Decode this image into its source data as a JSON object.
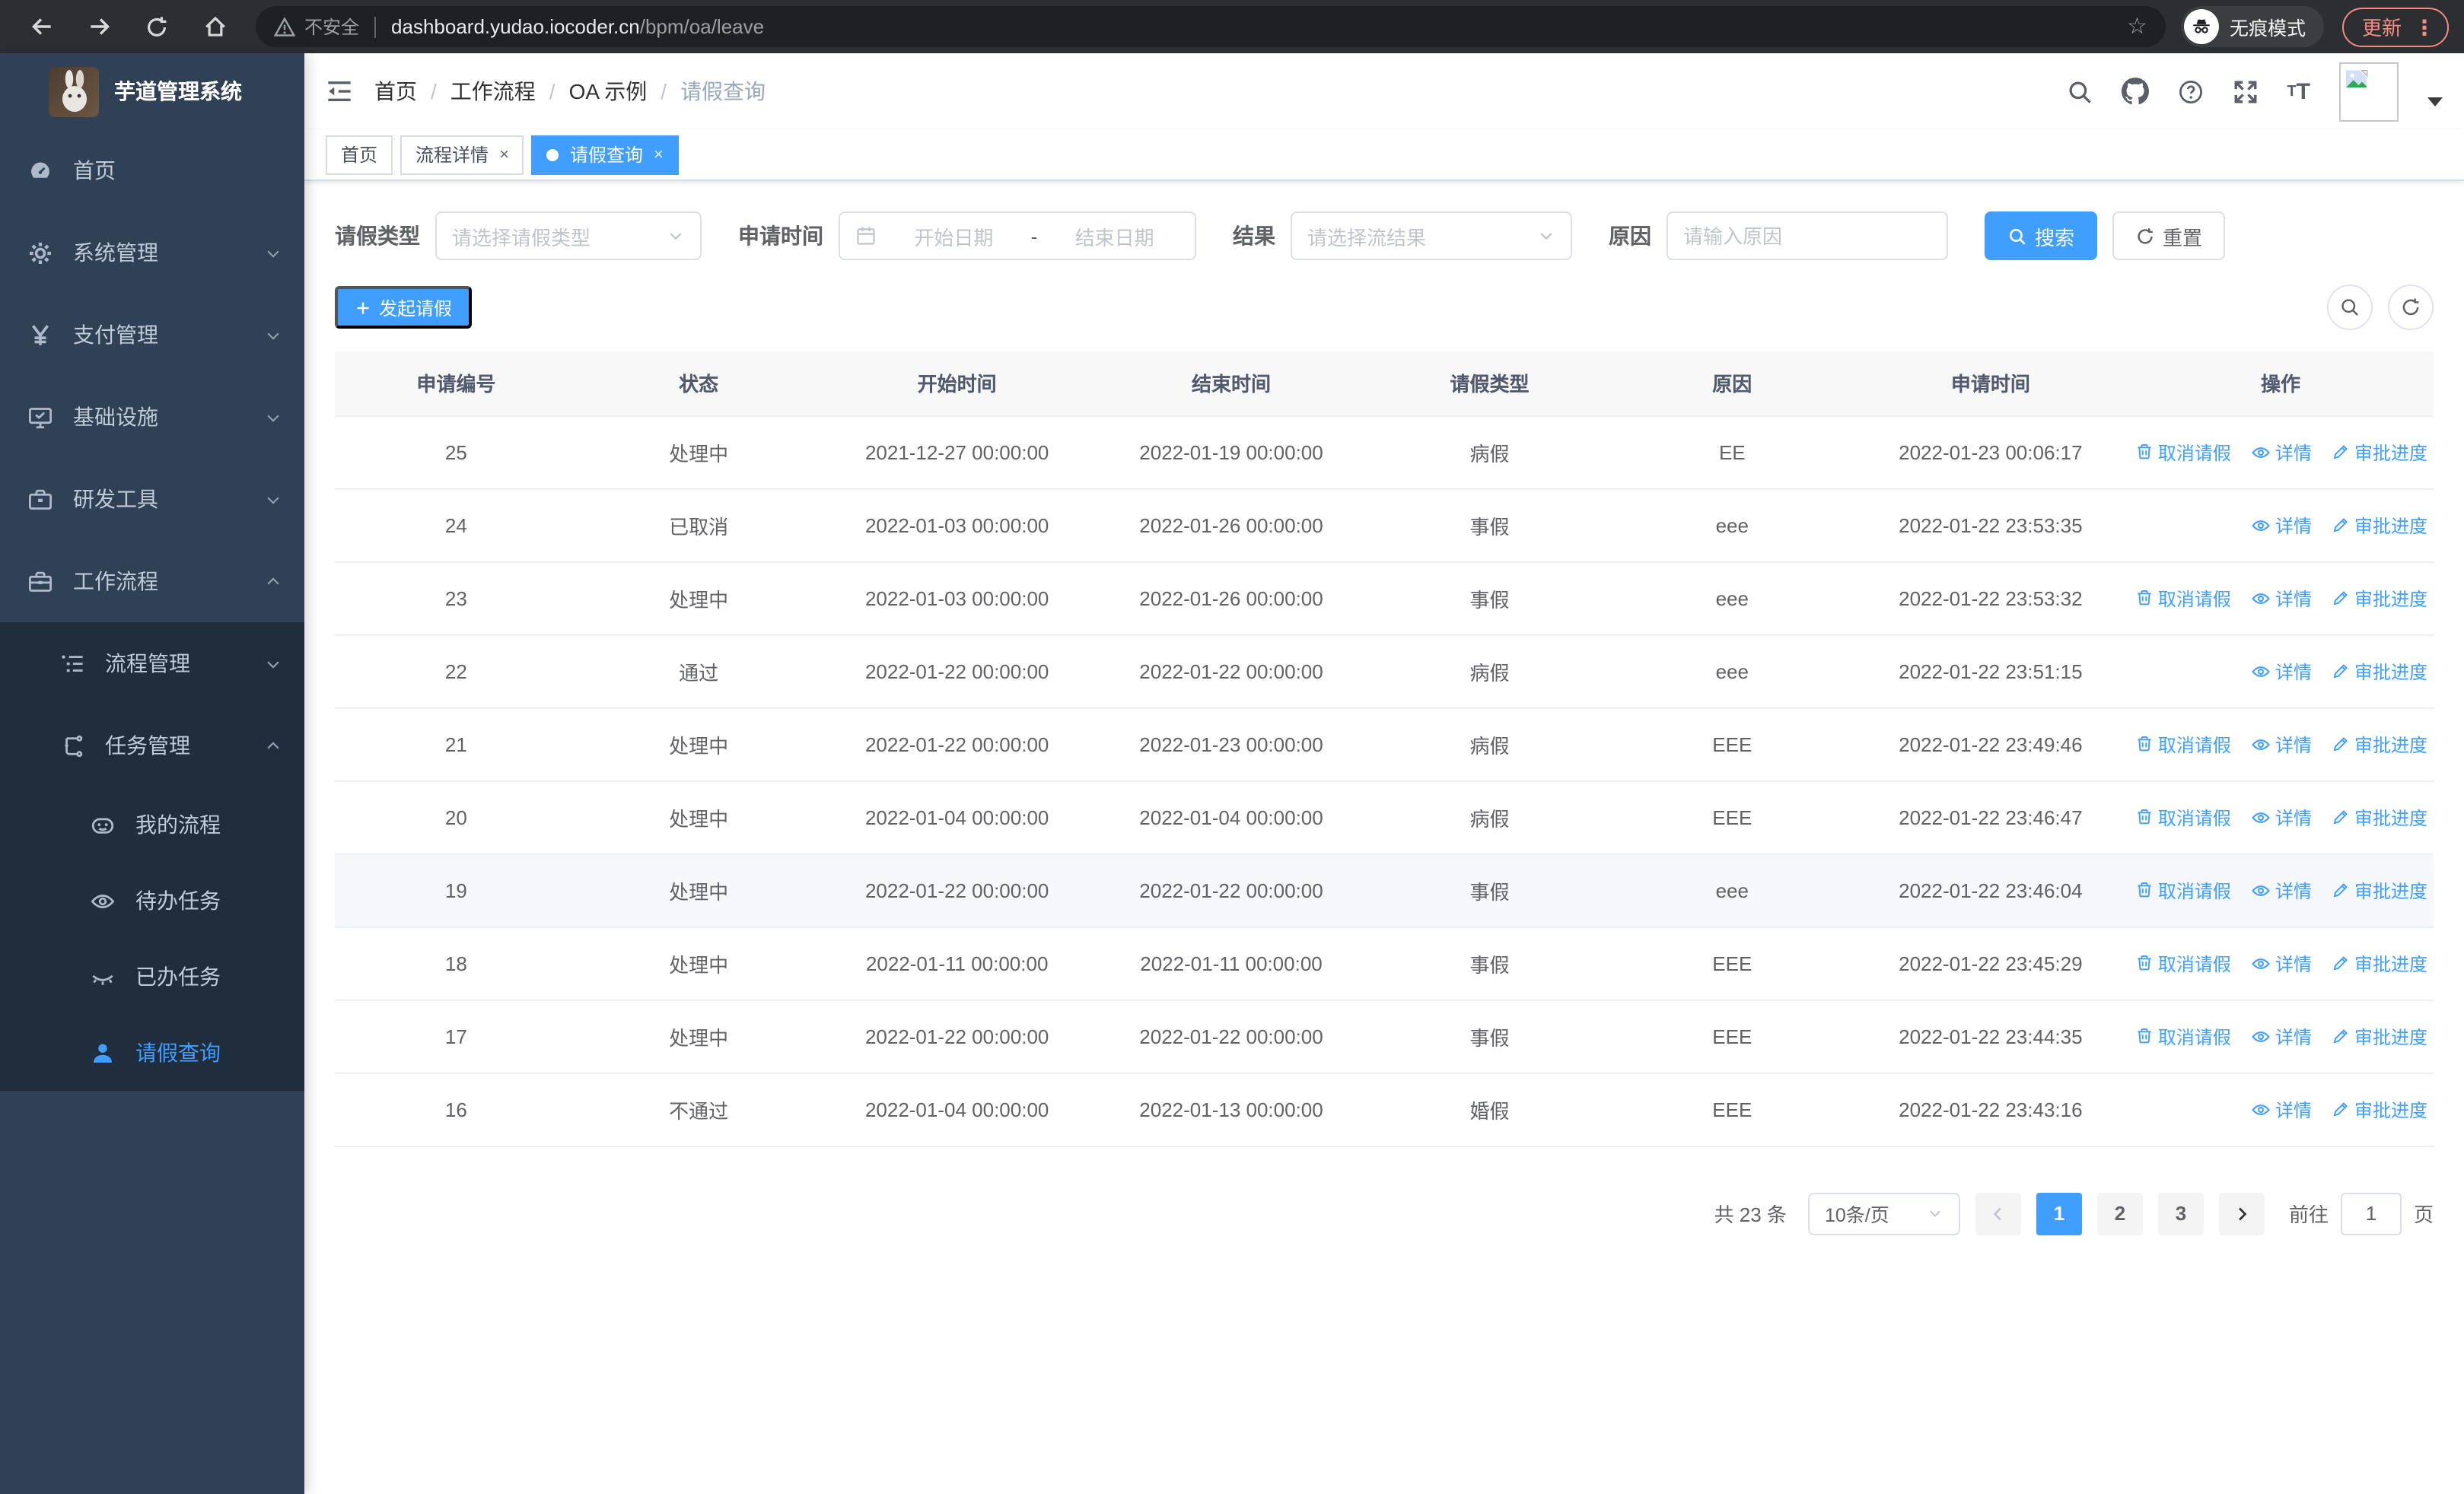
{
  "browser": {
    "security_label": "不安全",
    "url_host": "dashboard.yudao.iocoder.cn",
    "url_path": "/bpm/oa/leave",
    "incognito_label": "无痕模式",
    "update_label": "更新"
  },
  "icons": {
    "star": "☆",
    "dots": "⋮",
    "close": "×",
    "separator": "/"
  },
  "sidebar": {
    "title": "芋道管理系统",
    "menu": [
      {
        "label": "首页"
      },
      {
        "label": "系统管理"
      },
      {
        "label": "支付管理"
      },
      {
        "label": "基础设施"
      },
      {
        "label": "研发工具"
      },
      {
        "label": "工作流程"
      },
      {
        "label": "流程管理"
      },
      {
        "label": "任务管理"
      },
      {
        "label": "我的流程"
      },
      {
        "label": "待办任务"
      },
      {
        "label": "已办任务"
      },
      {
        "label": "请假查询"
      }
    ]
  },
  "navbar": {
    "breadcrumb": [
      "首页",
      "工作流程",
      "OA 示例",
      "请假查询"
    ]
  },
  "tags": [
    {
      "label": "首页"
    },
    {
      "label": "流程详情"
    },
    {
      "label": "请假查询"
    }
  ],
  "filters": {
    "leave_type_label": "请假类型",
    "leave_type_placeholder": "请选择请假类型",
    "apply_time_label": "申请时间",
    "start_date_placeholder": "开始日期",
    "range_separator": "-",
    "end_date_placeholder": "结束日期",
    "result_label": "结果",
    "result_placeholder": "请选择流结果",
    "reason_label": "原因",
    "reason_placeholder": "请输入原因",
    "search_label": "搜索",
    "reset_label": "重置"
  },
  "toolbar": {
    "create_label": "发起请假"
  },
  "table": {
    "columns": [
      "申请编号",
      "状态",
      "开始时间",
      "结束时间",
      "请假类型",
      "原因",
      "申请时间",
      "操作"
    ],
    "actions": {
      "cancel": "取消请假",
      "detail": "详情",
      "progress": "审批进度"
    },
    "rows": [
      {
        "id": "25",
        "status": "处理中",
        "start": "2021-12-27 00:00:00",
        "end": "2022-01-19 00:00:00",
        "type": "病假",
        "reason": "EE",
        "applied": "2022-01-23 00:06:17",
        "cancellable": true,
        "highlighted": false
      },
      {
        "id": "24",
        "status": "已取消",
        "start": "2022-01-03 00:00:00",
        "end": "2022-01-26 00:00:00",
        "type": "事假",
        "reason": "eee",
        "applied": "2022-01-22 23:53:35",
        "cancellable": false,
        "highlighted": false
      },
      {
        "id": "23",
        "status": "处理中",
        "start": "2022-01-03 00:00:00",
        "end": "2022-01-26 00:00:00",
        "type": "事假",
        "reason": "eee",
        "applied": "2022-01-22 23:53:32",
        "cancellable": true,
        "highlighted": false
      },
      {
        "id": "22",
        "status": "通过",
        "start": "2022-01-22 00:00:00",
        "end": "2022-01-22 00:00:00",
        "type": "病假",
        "reason": "eee",
        "applied": "2022-01-22 23:51:15",
        "cancellable": false,
        "highlighted": false
      },
      {
        "id": "21",
        "status": "处理中",
        "start": "2022-01-22 00:00:00",
        "end": "2022-01-23 00:00:00",
        "type": "病假",
        "reason": "EEE",
        "applied": "2022-01-22 23:49:46",
        "cancellable": true,
        "highlighted": false
      },
      {
        "id": "20",
        "status": "处理中",
        "start": "2022-01-04 00:00:00",
        "end": "2022-01-04 00:00:00",
        "type": "病假",
        "reason": "EEE",
        "applied": "2022-01-22 23:46:47",
        "cancellable": true,
        "highlighted": false
      },
      {
        "id": "19",
        "status": "处理中",
        "start": "2022-01-22 00:00:00",
        "end": "2022-01-22 00:00:00",
        "type": "事假",
        "reason": "eee",
        "applied": "2022-01-22 23:46:04",
        "cancellable": true,
        "highlighted": true
      },
      {
        "id": "18",
        "status": "处理中",
        "start": "2022-01-11 00:00:00",
        "end": "2022-01-11 00:00:00",
        "type": "事假",
        "reason": "EEE",
        "applied": "2022-01-22 23:45:29",
        "cancellable": true,
        "highlighted": false
      },
      {
        "id": "17",
        "status": "处理中",
        "start": "2022-01-22 00:00:00",
        "end": "2022-01-22 00:00:00",
        "type": "事假",
        "reason": "EEE",
        "applied": "2022-01-22 23:44:35",
        "cancellable": true,
        "highlighted": false
      },
      {
        "id": "16",
        "status": "不通过",
        "start": "2022-01-04 00:00:00",
        "end": "2022-01-13 00:00:00",
        "type": "婚假",
        "reason": "EEE",
        "applied": "2022-01-22 23:43:16",
        "cancellable": false,
        "highlighted": false
      }
    ]
  },
  "pagination": {
    "total_label": "共 23 条",
    "page_size_label": "10条/页",
    "pages": [
      "1",
      "2",
      "3"
    ],
    "active_page": "1",
    "goto_label": "前往",
    "goto_value": "1",
    "unit_label": "页"
  }
}
